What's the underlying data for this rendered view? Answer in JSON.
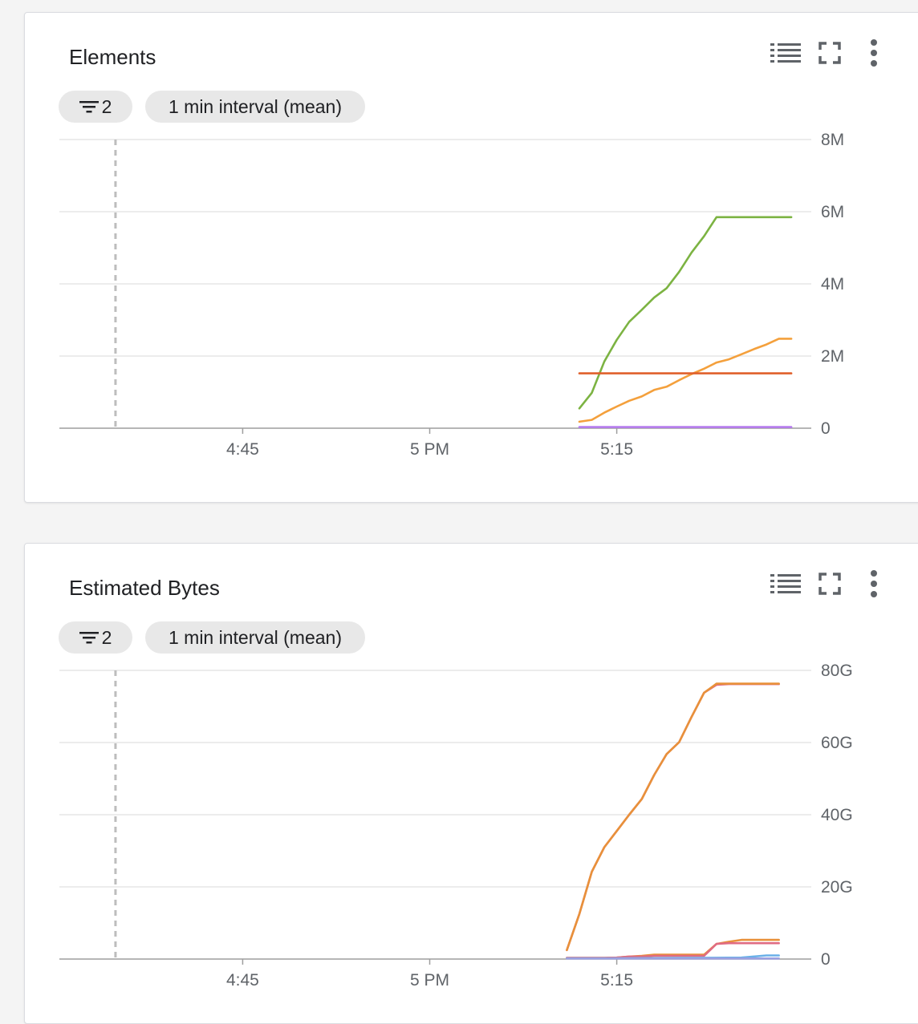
{
  "charts": [
    {
      "title": "Elements",
      "filter_count": "2",
      "interval_label": "1 min interval (mean)",
      "icons": [
        "legend-icon",
        "fullscreen-icon",
        "more-vert-icon"
      ],
      "chart_data": {
        "type": "line",
        "x_tick_labels": [
          "4:45",
          "5 PM",
          "5:15"
        ],
        "x_tick_minutes": [
          45,
          60,
          75
        ],
        "xlim_minutes": [
          30.3,
          90.6
        ],
        "marker_minute": 34.8,
        "y_tick_labels": [
          "0",
          "2M",
          "4M",
          "6M",
          "8M"
        ],
        "y_tick_values": [
          0,
          2000000,
          4000000,
          6000000,
          8000000
        ],
        "ylim": [
          0,
          8000000
        ],
        "grid": true,
        "series": [
          {
            "color": "#7cb342",
            "x": [
              72,
              73,
              74,
              75,
              76,
              77,
              78,
              79,
              80,
              81,
              82,
              83,
              84,
              85,
              86,
              87,
              88,
              89
            ],
            "y": [
              550000,
              980000,
              1850000,
              2450000,
              2950000,
              3280000,
              3620000,
              3880000,
              4330000,
              4870000,
              5320000,
              5850000,
              5850000,
              5850000,
              5850000,
              5850000,
              5850000,
              5850000
            ]
          },
          {
            "color": "#f4a03c",
            "x": [
              72,
              73,
              74,
              75,
              76,
              77,
              78,
              79,
              80,
              81,
              82,
              83,
              84,
              85,
              86,
              87,
              88,
              89
            ],
            "y": [
              180000,
              230000,
              430000,
              600000,
              760000,
              880000,
              1060000,
              1150000,
              1330000,
              1500000,
              1650000,
              1820000,
              1910000,
              2050000,
              2190000,
              2320000,
              2480000,
              2480000
            ]
          },
          {
            "color": "#e0602b",
            "x": [
              72,
              89
            ],
            "y": [
              1520000,
              1520000
            ]
          },
          {
            "color": "#b57bee",
            "x": [
              72,
              89
            ],
            "y": [
              30000,
              30000
            ]
          }
        ]
      }
    },
    {
      "title": "Estimated Bytes",
      "filter_count": "2",
      "interval_label": "1 min interval (mean)",
      "icons": [
        "legend-icon",
        "fullscreen-icon",
        "more-vert-icon"
      ],
      "chart_data": {
        "type": "line",
        "x_tick_labels": [
          "4:45",
          "5 PM",
          "5:15"
        ],
        "x_tick_minutes": [
          45,
          60,
          75
        ],
        "xlim_minutes": [
          30.3,
          90.6
        ],
        "marker_minute": 34.8,
        "y_tick_labels": [
          "0",
          "20G",
          "40G",
          "60G",
          "80G"
        ],
        "y_tick_values": [
          0,
          20000000000,
          40000000000,
          60000000000,
          80000000000
        ],
        "ylim": [
          0,
          80000000000
        ],
        "grid": true,
        "series": [
          {
            "color": "#e06b82",
            "x": [
              71,
              72,
              73,
              74,
              75,
              76,
              77,
              78,
              79,
              80,
              81,
              82,
              83,
              84,
              85,
              86,
              87,
              88
            ],
            "y": [
              2500000000,
              12500000000,
              24200000000,
              31000000000,
              35500000000,
              40000000000,
              44300000000,
              51000000000,
              56800000000,
              60100000000,
              67100000000,
              73800000000,
              76000000000,
              76200000000,
              76200000000,
              76200000000,
              76200000000,
              76200000000
            ]
          },
          {
            "color": "#e8913a",
            "x": [
              71,
              72,
              73,
              74,
              75,
              76,
              77,
              78,
              79,
              80,
              81,
              82,
              83,
              84,
              85,
              86,
              87,
              88
            ],
            "y": [
              2500000000,
              12500000000,
              24200000000,
              31000000000,
              35500000000,
              40000000000,
              44300000000,
              51000000000,
              56800000000,
              60100000000,
              67100000000,
              73800000000,
              76300000000,
              76300000000,
              76300000000,
              76300000000,
              76300000000,
              76300000000
            ]
          },
          {
            "color": "#e8913a",
            "x": [
              71,
              72,
              73,
              74,
              75,
              76,
              77,
              78,
              79,
              80,
              81,
              82,
              83,
              84,
              85,
              86,
              87,
              88
            ],
            "y": [
              300000000,
              300000000,
              300000000,
              300000000,
              400000000,
              700000000,
              900000000,
              1200000000,
              1200000000,
              1200000000,
              1200000000,
              1200000000,
              4200000000,
              4800000000,
              5300000000,
              5300000000,
              5300000000,
              5300000000
            ]
          },
          {
            "color": "#e06b82",
            "x": [
              71,
              72,
              73,
              74,
              75,
              76,
              77,
              78,
              79,
              80,
              81,
              82,
              83,
              84,
              85,
              86,
              87,
              88
            ],
            "y": [
              300000000,
              300000000,
              300000000,
              300000000,
              400000000,
              700000000,
              700000000,
              900000000,
              900000000,
              900000000,
              900000000,
              900000000,
              4200000000,
              4400000000,
              4400000000,
              4400000000,
              4400000000,
              4400000000
            ]
          },
          {
            "color": "#6ab0e8",
            "x": [
              71,
              75,
              80,
              85,
              87,
              88
            ],
            "y": [
              200000000,
              200000000,
              300000000,
              400000000,
              1000000000,
              1000000000
            ]
          },
          {
            "color": "#9aa0e0",
            "x": [
              71,
              88
            ],
            "y": [
              150000000,
              150000000
            ]
          }
        ]
      }
    }
  ]
}
